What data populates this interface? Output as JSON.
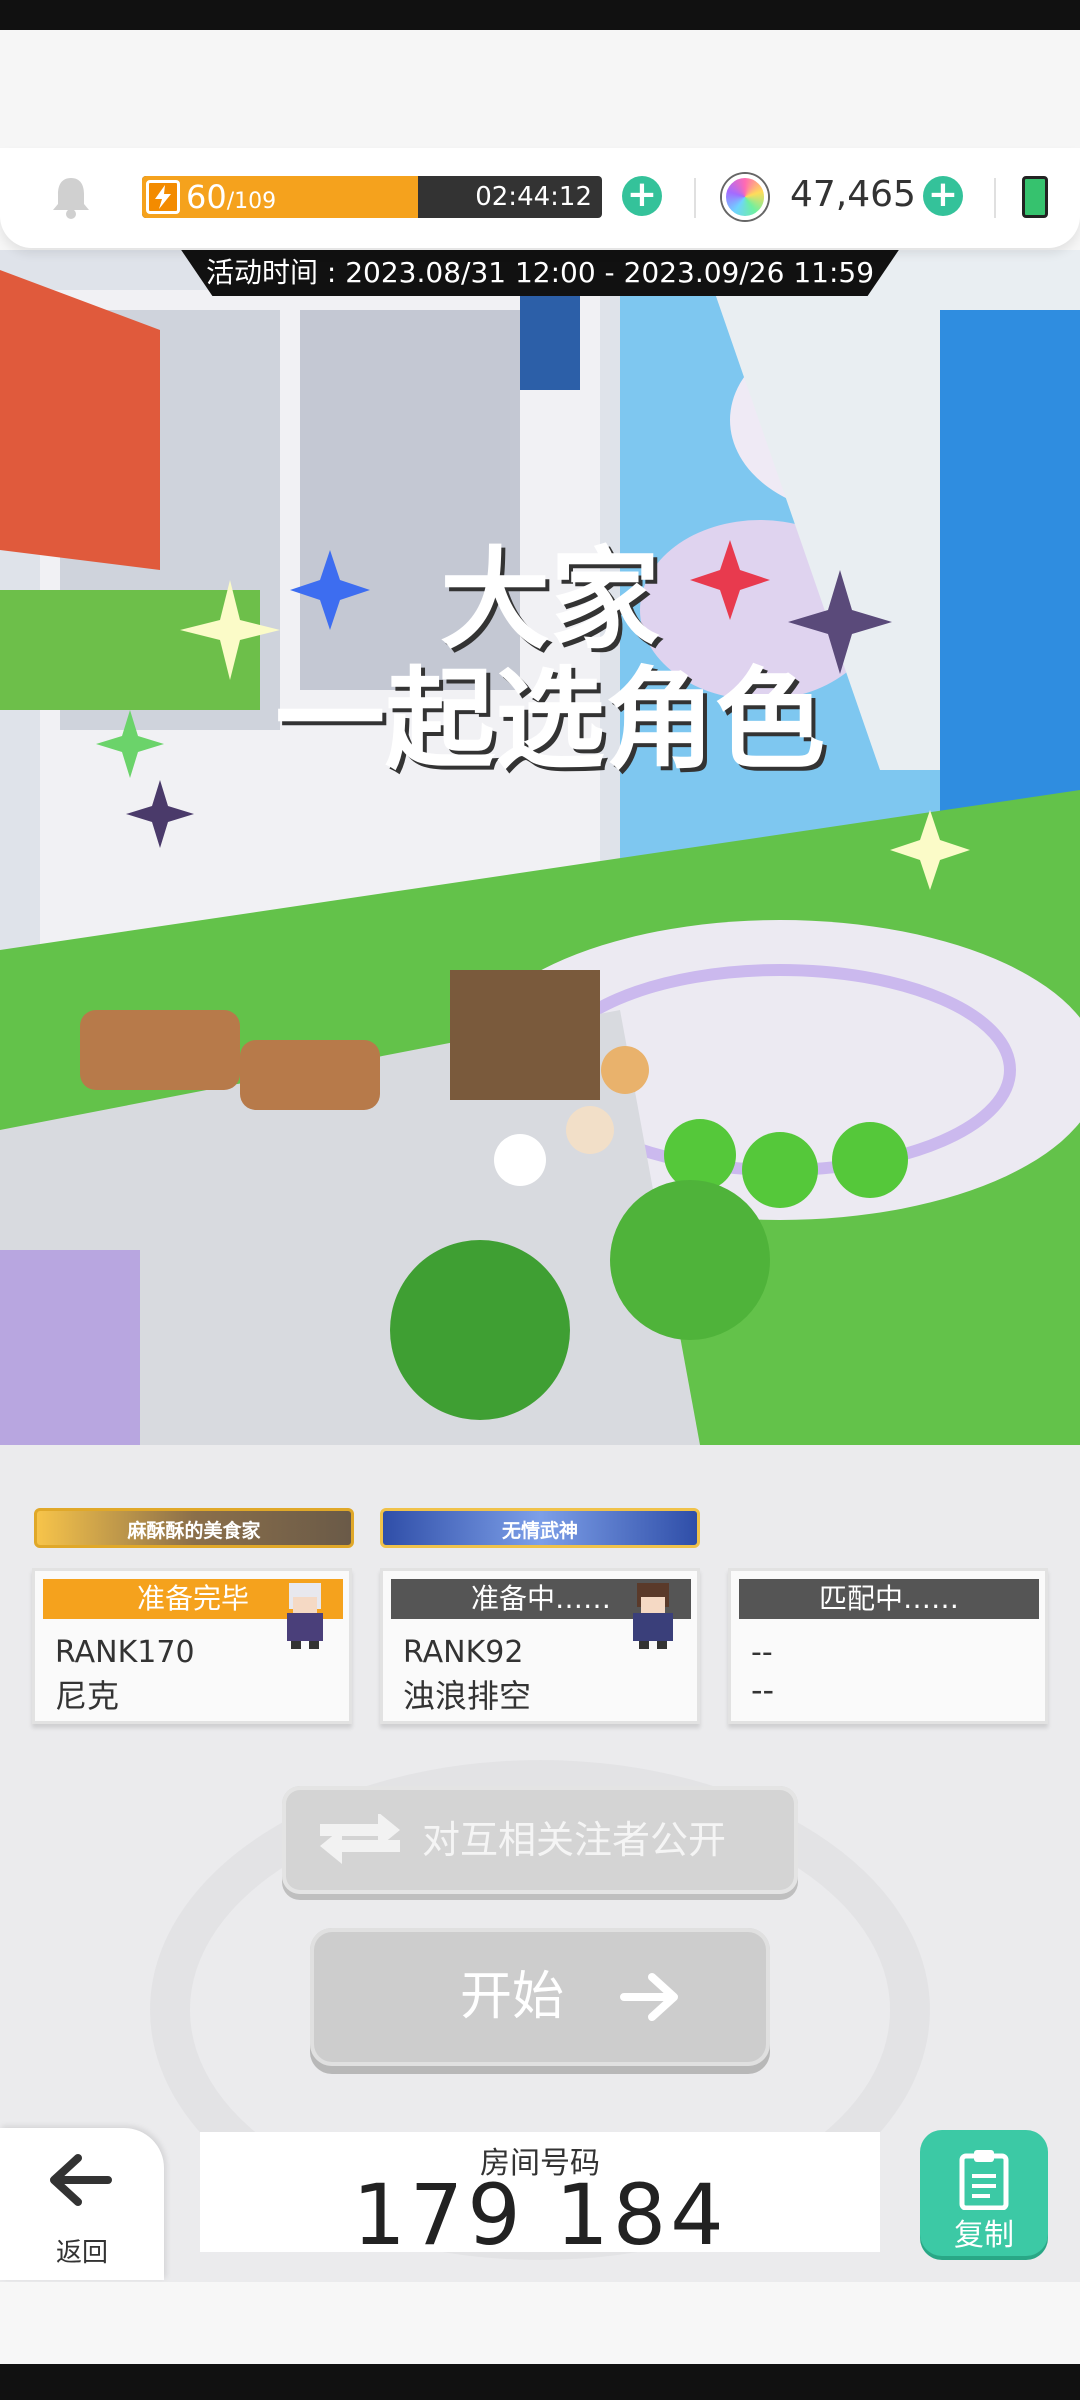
{
  "header": {
    "stamina": {
      "current": "60",
      "max": "/109",
      "timer": "02:44:12",
      "fill_fraction": 0.6
    },
    "gems": "47,465"
  },
  "event": {
    "time_text": "活动时间 : 2023.08/31 12:00 - 2023.09/26 11:59",
    "title_line1": "大家",
    "title_line2": "一起选角色"
  },
  "players": [
    {
      "badge": "麻酥酥的美食家",
      "status": "准备完毕",
      "status_color": "#f5a21d",
      "rank": "RANK170",
      "name": "尼克"
    },
    {
      "badge": "无情武神",
      "status": "准备中……",
      "status_color": "#555555",
      "rank": "RANK92",
      "name": "浊浪排空"
    },
    {
      "badge": "",
      "status": "匹配中……",
      "status_color": "#555555",
      "rank": "--",
      "name": "--"
    }
  ],
  "buttons": {
    "share_label": "对互相关注者公开",
    "start_label": "开始",
    "back_label": "返回",
    "copy_label": "复制"
  },
  "room": {
    "label": "房间号码",
    "number": "179 184"
  },
  "colors": {
    "accent_green": "#3cc9a5",
    "stamina_orange": "#f5a21d"
  }
}
